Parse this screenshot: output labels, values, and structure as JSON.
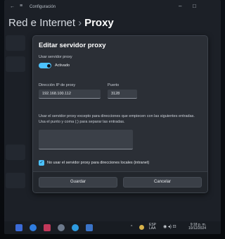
{
  "window": {
    "title": "Configuración",
    "back_glyph": "←",
    "menu_glyph": "≡",
    "min_glyph": "–",
    "max_glyph": "□"
  },
  "breadcrumb": {
    "parent": "Red e Internet",
    "separator": "›",
    "current": "Proxy"
  },
  "dialog": {
    "title": "Editar servidor proxy",
    "use_proxy_label": "Usar servidor proxy",
    "toggle_state_label": "Activado",
    "toggle_on": true,
    "ip_label": "Dirección IP de proxy",
    "ip_value": "192.168.100.112",
    "port_label": "Puerto",
    "port_value": "3128",
    "exceptions_description": "Usar el servidor proxy excepto para direcciones que empiecen con las siguientes entradas. Usa el punto y coma (;) para separar las entradas.",
    "exceptions_value": "",
    "local_checkbox_label": "No usar el servidor proxy para direcciones locales (intranet)",
    "local_checkbox_checked": true,
    "save_label": "Guardar",
    "cancel_label": "Cancelar"
  },
  "taskbar": {
    "lang_top": "ESP",
    "lang_bottom": "LAA",
    "time": "9:18 p. m.",
    "date": "10/12/2024",
    "chevron_glyph": "^"
  },
  "colors": {
    "accent": "#4cc2ff",
    "dialog_bg": "#2b2f36",
    "footer_bg": "#22262c"
  }
}
